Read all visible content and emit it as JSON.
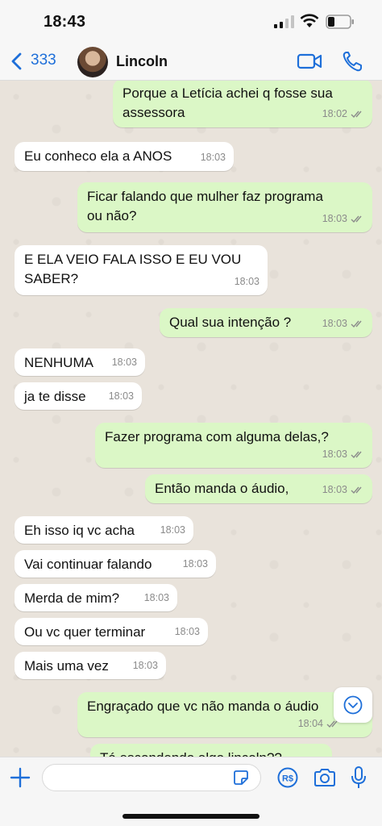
{
  "status_bar": {
    "time": "18:43"
  },
  "header": {
    "back_count": "333",
    "contact_name": "Lincoln"
  },
  "messages": [
    {
      "direction": "out",
      "text": "Porque a Letícia achei q fosse sua\nassessora",
      "time": "18:02",
      "read": true
    },
    {
      "direction": "in",
      "text": "Eu conheco ela a ANOS",
      "time": "18:03"
    },
    {
      "direction": "out",
      "text": "Ficar falando que mulher faz programa\nou não?",
      "time": "18:03",
      "read": true
    },
    {
      "direction": "in",
      "text": "E ELA VEIO FALA ISSO E EU VOU\nSABER?",
      "time": "18:03"
    },
    {
      "direction": "out",
      "text": "Qual sua intenção ?",
      "time": "18:03",
      "read": true
    },
    {
      "direction": "in",
      "text": "NENHUMA",
      "time": "18:03"
    },
    {
      "direction": "in",
      "text": "ja te disse",
      "time": "18:03"
    },
    {
      "direction": "out",
      "text": "Fazer programa com alguma delas,?",
      "time": "18:03",
      "read": true
    },
    {
      "direction": "out",
      "text": "Então manda o áudio,",
      "time": "18:03",
      "read": true
    },
    {
      "direction": "in",
      "text": "Eh isso iq vc acha",
      "time": "18:03"
    },
    {
      "direction": "in",
      "text": "Vai continuar falando",
      "time": "18:03"
    },
    {
      "direction": "in",
      "text": "Merda de mim?",
      "time": "18:03"
    },
    {
      "direction": "in",
      "text": "Ou vc quer terminar",
      "time": "18:03"
    },
    {
      "direction": "in",
      "text": "Mais uma vez",
      "time": "18:03"
    },
    {
      "direction": "out",
      "text": "Engraçado que vc não manda o áudio",
      "time": "18:04",
      "read": true
    },
    {
      "direction": "out",
      "text": "Tá escondendo algo lincoln??",
      "time": "",
      "read": false
    }
  ],
  "composer": {
    "placeholder": ""
  },
  "colors": {
    "accent": "#1e6fd9",
    "outgoing_bubble": "#dbf7c6",
    "incoming_bubble": "#ffffff",
    "read_check": "#8b8b8b"
  },
  "icons": [
    "back-icon",
    "video-icon",
    "phone-icon",
    "plus-icon",
    "sticker-icon",
    "currency-icon",
    "camera-icon",
    "mic-icon",
    "chevron-down-icon",
    "double-check-icon"
  ]
}
